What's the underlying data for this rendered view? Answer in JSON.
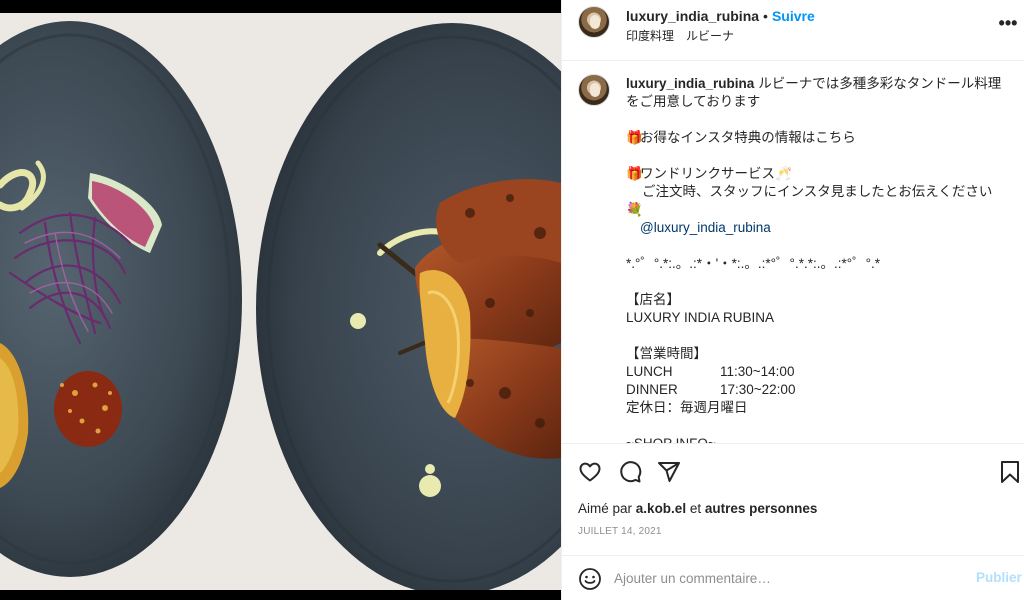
{
  "post": {
    "username": "luxury_india_rubina",
    "separator": "•",
    "follow_label": "Suivre",
    "location": "印度料理　ルビーナ",
    "more_label": "•••"
  },
  "caption": {
    "username": "luxury_india_rubina",
    "intro": "ルビーナでは多種多彩なタンドール料理をご用意しております",
    "gift_emoji": "🎁",
    "cheers_emoji": "🥂",
    "flower_emoji": "💐",
    "benefits": "お得なインスタ特典の情報はこちら",
    "one_drink": "ワンドリンクサービス",
    "instruction": "ご注文時、スタッフにインスタ見ましたとお伝えください",
    "mention": "@luxury_india_rubina",
    "divider": "*.°゜°.*:.。.:*・'・*:.。.:*°゜°.*.*:.。.:*°゜°.*",
    "shop_name_heading": "【店名】",
    "shop_name": "LUXURY INDIA RUBINA",
    "hours_heading": "【営業時間】",
    "lunch_label": "LUNCH",
    "lunch_time": "11:30~14:00",
    "dinner_label": "DINNER",
    "dinner_time": "17:30~22:00",
    "closed": "定休日：毎週月曜日",
    "shop_info": "~SHOP INFO~"
  },
  "actions": {
    "liked_prefix": "Aimé par",
    "liked_user": "a.kob.el",
    "liked_middle": "et",
    "liked_others": "autres personnes",
    "date": "JUILLET 14, 2021"
  },
  "comment_box": {
    "placeholder": "Ajouter un commentaire…",
    "publish_label": "Publier"
  },
  "colors": {
    "accent": "#0095f6",
    "publish_disabled": "#b2dffc",
    "plate": "#3a4650",
    "background_table": "#ece9e4"
  },
  "icons": [
    "like-icon",
    "comment-icon",
    "share-icon",
    "save-icon",
    "smile-icon",
    "more-icon"
  ]
}
